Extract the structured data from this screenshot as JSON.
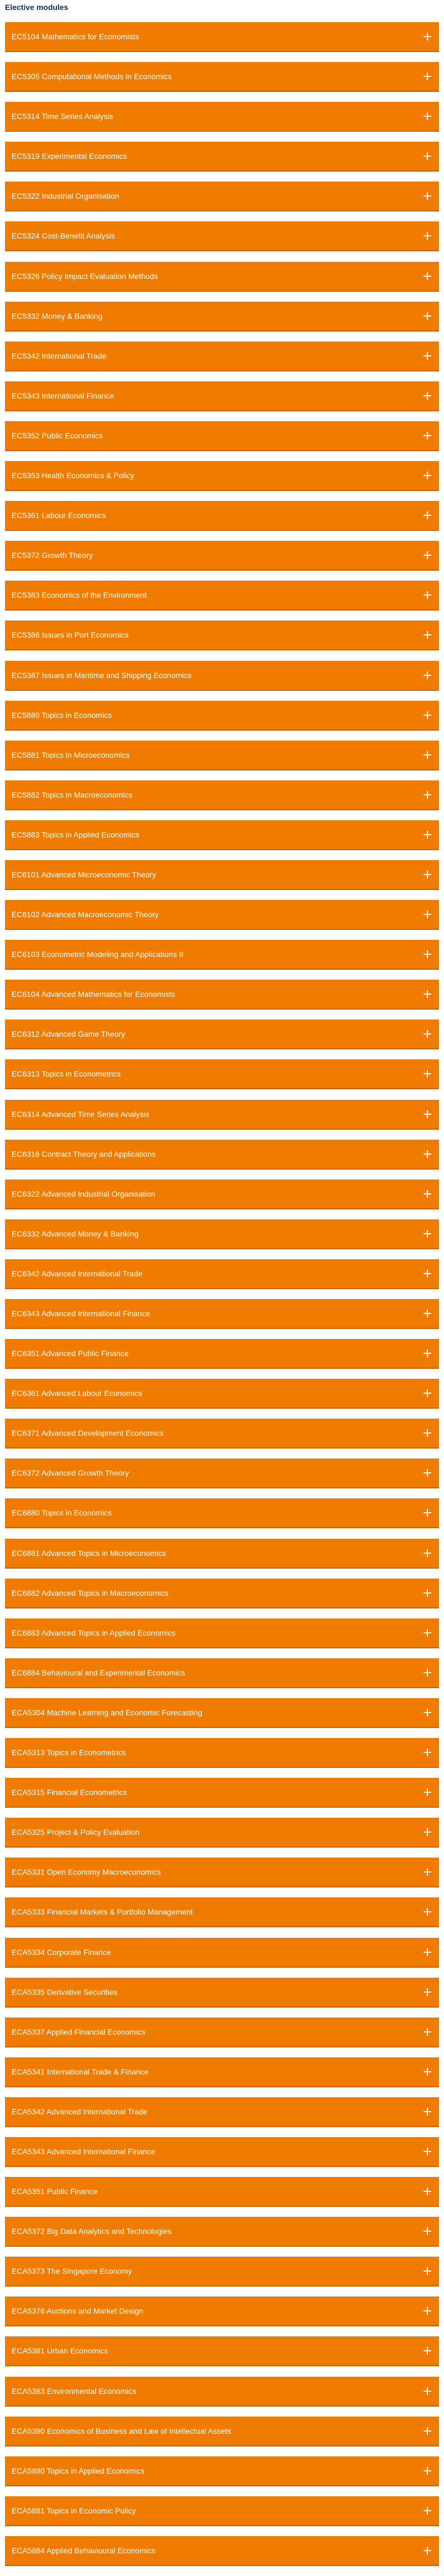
{
  "section": {
    "title": "Elective modules"
  },
  "icons": {
    "expand": "plus-icon"
  },
  "colors": {
    "accent": "#ef7c00",
    "title": "#0b2e6e",
    "label": "#ffffff"
  },
  "modules": [
    "EC5104 Mathematics for Economists",
    "EC5305 Computational Methods in Economics",
    "EC5314 Time Series Analysis",
    "EC5319 Experimental Economics",
    "EC5322 Industrial Organisation",
    "EC5324 Cost-Benefit Analysis",
    "EC5326 Policy Impact Evaluation Methods",
    "EC5332 Money & Banking",
    "EC5342 International Trade",
    "EC5343 International Finance",
    "EC5352 Public Economics",
    "EC5353 Health Economics & Policy",
    "EC5361 Labour Economics",
    "EC5372 Growth Theory",
    "EC5383 Economics of the Environment",
    "EC5386 Issues in Port Economics",
    "EC5387 Issues in Maritime and Shipping Economics",
    "EC5880 Topics in Economics",
    "EC5881 Topics in Microeconomics",
    "EC5882 Topics in Macroeconomics",
    "EC5883 Topics in Applied Economics",
    "EC6101 Advanced Microeconomic Theory",
    "EC6102 Advanced Macroeconomic Theory",
    "EC6103 Econometric Modeling and Applications II",
    "EC6104 Advanced Mathematics for Economists",
    "EC6312 Advanced Game Theory",
    "EC6313 Topics in Econometrics",
    "EC6314 Advanced Time Series Analysis",
    "EC6316 Contract Theory and Applications",
    "EC6322 Advanced Industrial Organisation",
    "EC6332 Advanced Money & Banking",
    "EC6342 Advanced International Trade",
    "EC6343 Advanced International Finance",
    "EC6351 Advanced Public Finance",
    "EC6361 Advanced Labour Economics",
    "EC6371 Advanced Development Economics",
    "EC6372 Advanced Growth Theory",
    "EC6880 Topics in Economics",
    "EC6881 Advanced Topics in Microeconomics",
    "EC6882 Advanced Topics in Macroeconomics",
    "EC6883 Advanced Topics in Applied Economics",
    "EC6884 Behavioural and Experimental Economics",
    "ECA5304 Machine Learning and Economic Forecasting",
    "ECA5313 Topics in Econometrics",
    "ECA5315 Financial Econometrics",
    "ECA5325 Project & Policy Evaluation",
    "ECA5331 Open Economy Macroeconomics",
    "ECA5333 Financial Markets & Portfolio Management",
    "ECA5334 Corporate Finance",
    "ECA5335 Derivative Securities",
    "ECA5337 Applied Financial Economics",
    "ECA5341 International Trade & Finance",
    "ECA5342 Advanced International Trade",
    "ECA5343 Advanced International Finance",
    "ECA5351 Public Finance",
    "ECA5372 Big Data Analytics and Technologies",
    "ECA5373 The Singapore Economy",
    "ECA5376 Auctions and Market Design",
    "ECA5381 Urban Economics",
    "ECA5383 Environmental Economics",
    "ECA5390 Economics of Business and Law of Intellectual Assets",
    "ECA5880 Topics in Applied Economics",
    "ECA5881 Topics in Economic Policy",
    "ECA5884 Applied Behavioural Economics"
  ]
}
